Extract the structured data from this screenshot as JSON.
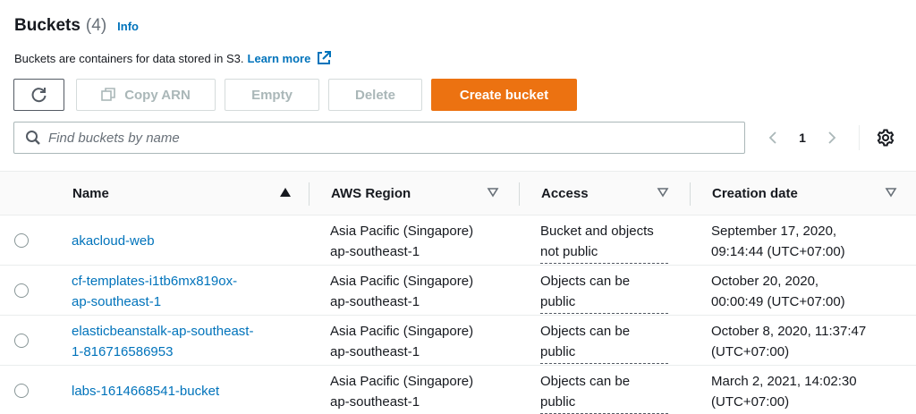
{
  "header": {
    "title": "Buckets",
    "count": "(4)",
    "info": "Info",
    "description": "Buckets are containers for data stored in S3.",
    "learn_more": "Learn more"
  },
  "toolbar": {
    "copy_arn": "Copy ARN",
    "empty": "Empty",
    "delete": "Delete",
    "create_bucket": "Create bucket",
    "accent_color": "#ec7211"
  },
  "search": {
    "placeholder": "Find buckets by name"
  },
  "pagination": {
    "current_page": "1"
  },
  "table": {
    "columns": [
      "Name",
      "AWS Region",
      "Access",
      "Creation date"
    ],
    "rows": [
      {
        "name_line1": "akacloud-web",
        "name_line2": "",
        "region_line1": "Asia Pacific (Singapore)",
        "region_line2": "ap-southeast-1",
        "access_line1": "Bucket and objects",
        "access_line2": "not public",
        "created_line1": "September 17, 2020,",
        "created_line2": "09:14:44 (UTC+07:00)"
      },
      {
        "name_line1": "cf-templates-i1tb6mx819ox-",
        "name_line2": "ap-southeast-1",
        "region_line1": "Asia Pacific (Singapore)",
        "region_line2": "ap-southeast-1",
        "access_line1": "Objects can be",
        "access_line2": "public",
        "created_line1": "October 20, 2020,",
        "created_line2": "00:00:49 (UTC+07:00)"
      },
      {
        "name_line1": "elasticbeanstalk-ap-southeast-",
        "name_line2": "1-816716586953",
        "region_line1": "Asia Pacific (Singapore)",
        "region_line2": "ap-southeast-1",
        "access_line1": "Objects can be",
        "access_line2": "public",
        "created_line1": "October 8, 2020, 11:37:47",
        "created_line2": "(UTC+07:00)"
      },
      {
        "name_line1": "labs-1614668541-bucket",
        "name_line2": "",
        "region_line1": "Asia Pacific (Singapore)",
        "region_line2": "ap-southeast-1",
        "access_line1": "Objects can be",
        "access_line2": "public",
        "created_line1": "March 2, 2021, 14:02:30",
        "created_line2": "(UTC+07:00)"
      }
    ]
  }
}
